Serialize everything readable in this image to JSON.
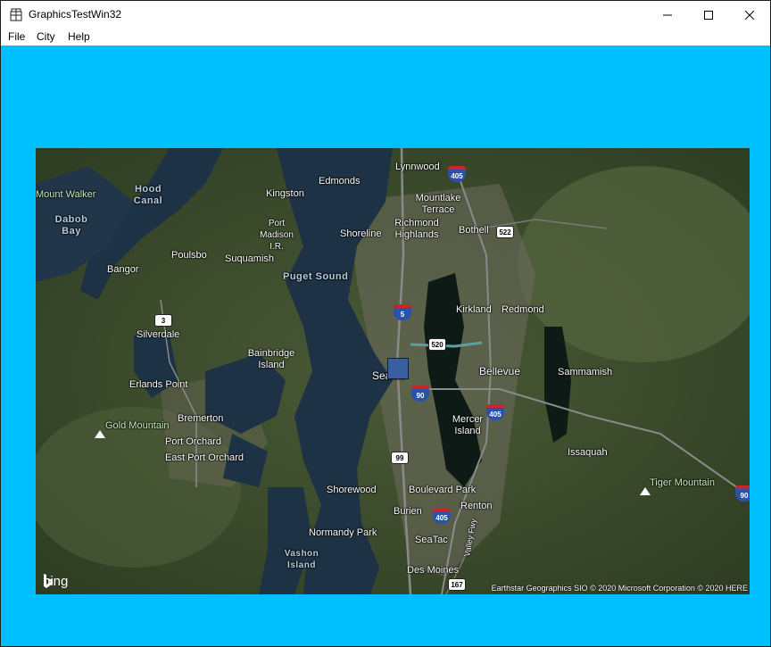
{
  "window": {
    "title": "GraphicsTestWin32",
    "controls": [
      "minimize",
      "maximize",
      "close"
    ]
  },
  "menu": {
    "items": [
      "File",
      "City",
      "Help"
    ]
  },
  "client": {
    "background": "#00bfff"
  },
  "map": {
    "provider_logo": "bing",
    "attribution": "Earthstar Geographics SIO © 2020 Microsoft Corporation © 2020 HERE",
    "labels": {
      "lynnwood": "Lynnwood",
      "edmonds": "Edmonds",
      "kingston": "Kingston",
      "mount_walker": "Mount Walker",
      "hood_canal": "Hood Canal",
      "dabob_bay": "Dabob Bay",
      "port_madison": "Port Madison I.R.",
      "mountlake_terrace": "Mountlake Terrace",
      "richmond_highlands": "Richmond Highlands",
      "shoreline": "Shoreline",
      "bothell": "Bothell",
      "bangor": "Bangor",
      "poulsbo": "Poulsbo",
      "suquamish": "Suquamish",
      "puget_sound": "Puget Sound",
      "kirkland": "Kirkland",
      "redmond": "Redmond",
      "silverdale": "Silverdale",
      "bainbridge_island": "Bainbridge Island",
      "seattle": "Seattle",
      "bellevue": "Bellevue",
      "sammamish": "Sammamish",
      "erlands_point": "Erlands Point",
      "bremerton": "Bremerton",
      "gold_mountain": "Gold Mountain",
      "mercer_island": "Mercer Island",
      "port_orchard": "Port Orchard",
      "east_port_orchard": "East Port Orchard",
      "issaquah": "Issaquah",
      "shorewood": "Shorewood",
      "boulevard_park": "Boulevard Park",
      "tiger_mountain": "Tiger Mountain",
      "burien": "Burien",
      "renton": "Renton",
      "normandy_park": "Normandy Park",
      "seatac": "SeaTac",
      "vashon_island": "Vashon Island",
      "valley_fwy": "Valley Fwy",
      "des_moines": "Des Moines"
    },
    "shields": {
      "i405_north": "405",
      "sr522": "522",
      "sr3": "3",
      "i5": "5",
      "sr520": "520",
      "i90": "90",
      "i405_east": "405",
      "sr99": "99",
      "i405_south": "405",
      "sr167": "167",
      "i90_east": "90"
    }
  }
}
